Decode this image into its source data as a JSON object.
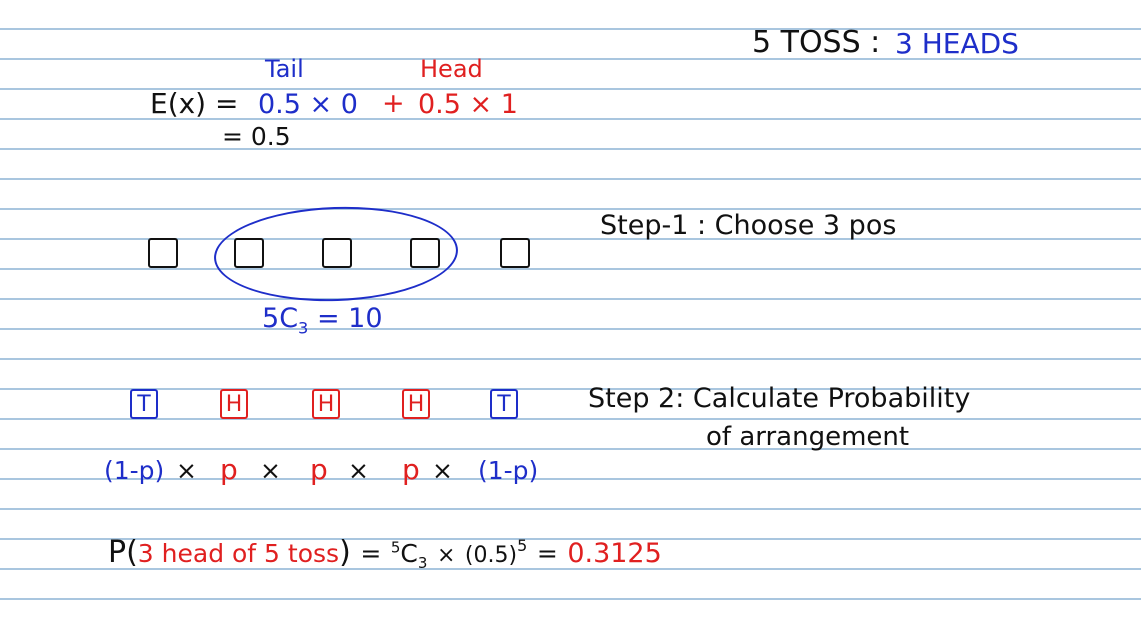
{
  "colors": {
    "ink": "#111111",
    "blue": "#1e2ec9",
    "red": "#e02020",
    "rule": "#a9c6df"
  },
  "header": {
    "toss": "5 TOSS :",
    "heads": "3 HEADS"
  },
  "expectation": {
    "tail_label": "Tail",
    "head_label": "Head",
    "lhs": "E(x) =",
    "tail_term": "0.5 × 0",
    "plus": "+",
    "head_term": "0.5 × 1",
    "result": "= 0.5"
  },
  "step1": {
    "label": "Step-1 : Choose 3 pos",
    "combo_n": "5",
    "combo_c": "C",
    "combo_k": "3",
    "combo_value": "= 10"
  },
  "step2": {
    "label_line1": "Step 2: Calculate Probability",
    "label_line2": "of arrangement",
    "boxes": [
      "T",
      "H",
      "H",
      "H",
      "T"
    ],
    "terms": [
      {
        "text": "(1-p)",
        "color": "blue"
      },
      {
        "text": "×",
        "color": "black"
      },
      {
        "text": "p",
        "color": "red"
      },
      {
        "text": "×",
        "color": "black"
      },
      {
        "text": "p",
        "color": "red"
      },
      {
        "text": "×",
        "color": "black"
      },
      {
        "text": "p",
        "color": "red"
      },
      {
        "text": "×",
        "color": "black"
      },
      {
        "text": "(1-p)",
        "color": "blue"
      }
    ]
  },
  "final": {
    "p_open": "P(",
    "event": "3 head of 5 toss",
    "p_close": ")",
    "equals1": "=",
    "combo_n": "5",
    "combo_c": "C",
    "combo_k": "3",
    "times": "×",
    "base": "(0.5)",
    "exp": "5",
    "equals2": "=",
    "answer": "0.3125"
  }
}
